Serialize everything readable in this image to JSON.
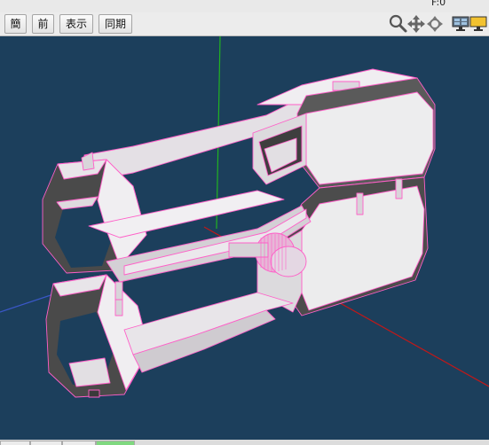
{
  "frame_counter": "F:0",
  "toolbar": {
    "buttons": [
      "簡",
      "前",
      "表示",
      "同期"
    ]
  },
  "tools": {
    "zoom_icon": "magnifier-icon",
    "pan_icon": "move-arrows-icon",
    "rotate_icon": "rotate-arrows-icon",
    "layout_icon": "monitor-layout-icon",
    "display_icon": "display-icon"
  },
  "colors": {
    "viewport_bg": "#1c3f5c",
    "model_face": "#e9e6ea",
    "model_edge": "#ff5fc8",
    "model_dark": "#4f4f4f",
    "axis_x": "#c21818",
    "axis_y": "#21b321",
    "axis_z": "#3a57c7",
    "selected_tab": "#7fd87f"
  }
}
